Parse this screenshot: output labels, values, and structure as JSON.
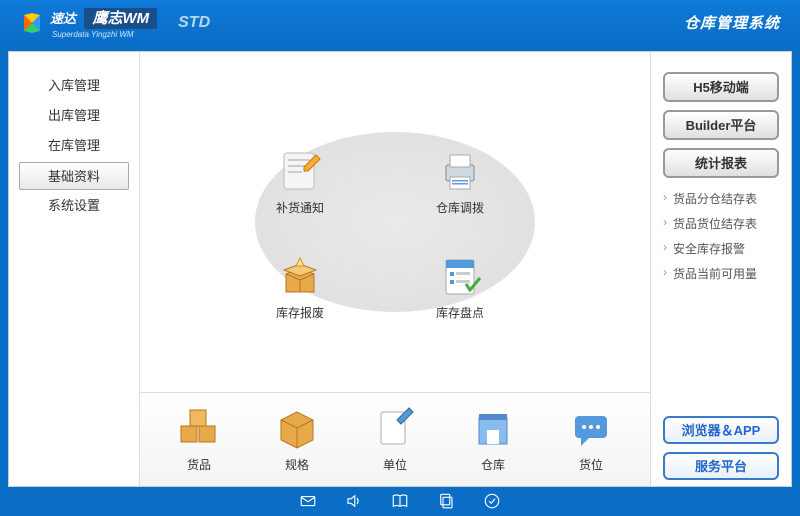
{
  "header": {
    "logo_text": "速达",
    "brand": "鹰志WM",
    "slogan": "Superdata Yingzhi WM",
    "edition": "STD",
    "system_title": "仓库管理系统"
  },
  "sidebar": {
    "items": [
      {
        "label": "入库管理",
        "active": false
      },
      {
        "label": "出库管理",
        "active": false
      },
      {
        "label": "在库管理",
        "active": false
      },
      {
        "label": "基础资料",
        "active": true
      },
      {
        "label": "系统设置",
        "active": false
      }
    ]
  },
  "oval": {
    "top_left": "补货通知",
    "top_right": "仓库调拨",
    "bottom_left": "库存报废",
    "bottom_right": "库存盘点"
  },
  "bottom_items": [
    {
      "label": "货品"
    },
    {
      "label": "规格"
    },
    {
      "label": "单位"
    },
    {
      "label": "仓库"
    },
    {
      "label": "货位"
    }
  ],
  "right_panel": {
    "buttons": [
      "H5移动端",
      "Builder平台",
      "统计报表"
    ],
    "links": [
      "货品分仓结存表",
      "货品货位结存表",
      "安全库存报警",
      "货品当前可用量"
    ],
    "bottom_buttons": [
      "浏览器＆APP",
      "服务平台"
    ]
  },
  "footer_icons": [
    "mail",
    "sound",
    "book",
    "copy",
    "check"
  ]
}
